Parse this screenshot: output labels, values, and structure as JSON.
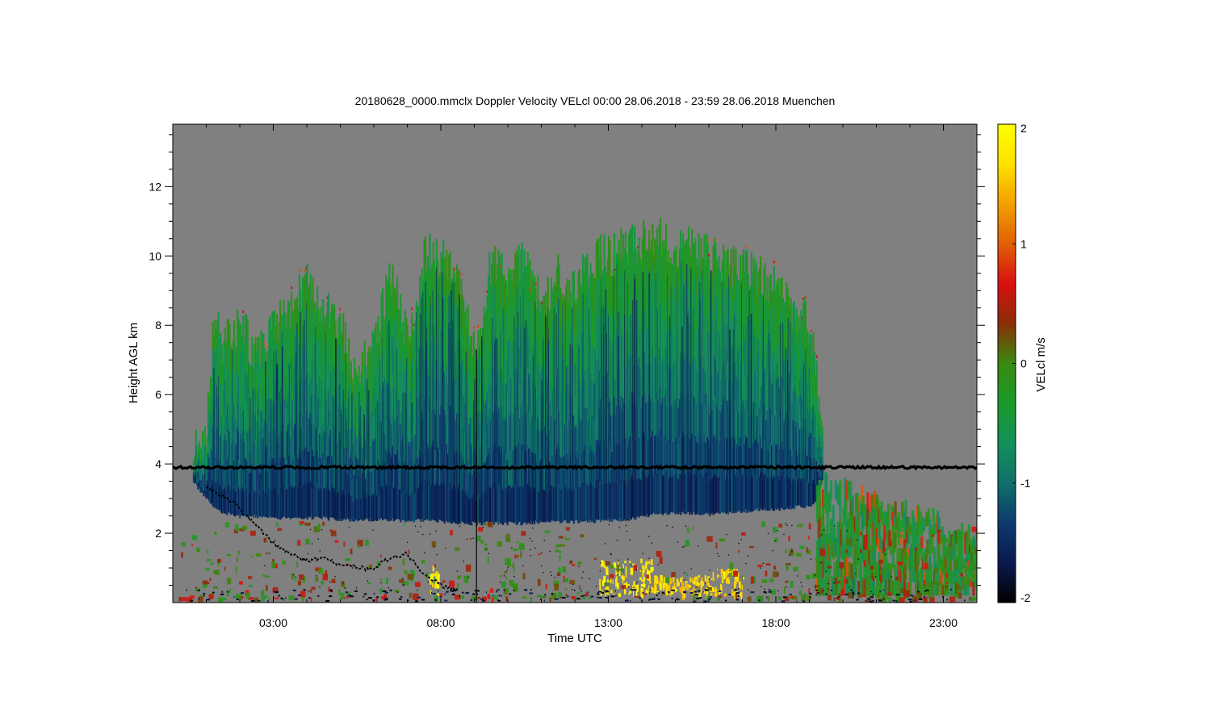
{
  "chart_data": {
    "type": "heatmap",
    "title": "20180628_0000.mmclx Doppler Velocity VELcl   00:00 28.06.2018 - 23:59 28.06.2018 Muenchen",
    "xlabel": "Time UTC",
    "ylabel": "Height AGL km",
    "x_unit": "hours UTC",
    "xlim": [
      0,
      24
    ],
    "ylim": [
      0,
      13.8
    ],
    "x_tick_values": [
      3,
      8,
      13,
      18,
      23
    ],
    "x_tick_labels": [
      "03:00",
      "08:00",
      "13:00",
      "18:00",
      "23:00"
    ],
    "y_tick_values": [
      2,
      4,
      6,
      8,
      10,
      12
    ],
    "y_tick_labels": [
      "2",
      "4",
      "6",
      "8",
      "10",
      "12"
    ],
    "colorbar": {
      "label": "VELcl m/s",
      "range": [
        -2,
        2
      ],
      "tick_values": [
        -2,
        -1,
        0,
        1,
        2
      ],
      "tick_labels": [
        "-2",
        "-1",
        "0",
        "1",
        "2"
      ],
      "colormap": [
        "#000000",
        "#0a1a50",
        "#0d3a6e",
        "#10706a",
        "#14905a",
        "#1a9a2a",
        "#3a8a10",
        "#8a2e08",
        "#d81010",
        "#e06006",
        "#f2a000",
        "#ffe100",
        "#ffff00"
      ]
    },
    "background_color": "#808080",
    "noise_band_height_km": 3.9,
    "cloud_mass": {
      "time": [
        0.6,
        1.0,
        1.2,
        1.5,
        2.0,
        2.5,
        3.0,
        3.5,
        4.0,
        4.5,
        5.0,
        5.5,
        6.0,
        6.5,
        7.0,
        7.5,
        8.0,
        8.5,
        9.0,
        9.5,
        10.0,
        10.5,
        11.0,
        11.5,
        12.0,
        12.5,
        13.0,
        13.5,
        14.0,
        14.5,
        15.0,
        15.5,
        16.0,
        16.5,
        17.0,
        17.5,
        18.0,
        18.5,
        19.0,
        19.2,
        19.4
      ],
      "top_km": [
        4.4,
        5.0,
        8.0,
        7.5,
        8.0,
        7.0,
        8.0,
        8.5,
        9.3,
        8.5,
        8.0,
        6.5,
        7.5,
        9.5,
        7.5,
        10.0,
        10.0,
        9.5,
        7.0,
        10.0,
        9.5,
        10.0,
        8.5,
        9.5,
        9.0,
        10.0,
        10.0,
        10.3,
        10.4,
        10.5,
        10.3,
        10.2,
        10.0,
        9.8,
        9.7,
        9.5,
        9.0,
        8.5,
        8.0,
        6.5,
        4.2
      ],
      "base_km": [
        3.5,
        3.0,
        2.8,
        2.6,
        2.5,
        2.5,
        2.45,
        2.45,
        2.45,
        2.45,
        2.4,
        2.4,
        2.4,
        2.4,
        2.35,
        2.4,
        2.35,
        2.3,
        2.3,
        2.3,
        2.3,
        2.3,
        2.35,
        2.35,
        2.35,
        2.35,
        2.4,
        2.4,
        2.5,
        2.6,
        2.6,
        2.6,
        2.55,
        2.6,
        2.65,
        2.7,
        2.7,
        2.75,
        2.8,
        3.0,
        3.6
      ]
    },
    "melting_layer_km": {
      "time": [
        1.0,
        1.8,
        2.5,
        3.0,
        3.5,
        4.0,
        4.5,
        5.0,
        5.5,
        6.0,
        6.5,
        7.0,
        7.5,
        8.0,
        8.5
      ],
      "height": [
        3.3,
        2.9,
        2.2,
        1.7,
        1.4,
        1.2,
        1.3,
        1.1,
        1.0,
        1.0,
        1.3,
        1.4,
        0.8,
        0.5,
        0.35
      ]
    },
    "updraft_patches": [
      {
        "t0": 12.7,
        "t1": 14.3,
        "h_max": 1.3,
        "velocity_ms": 2.0
      },
      {
        "t0": 14.3,
        "t1": 16.0,
        "h_max": 0.8,
        "velocity_ms": 1.8
      },
      {
        "t0": 16.0,
        "t1": 17.0,
        "h_max": 1.0,
        "velocity_ms": 1.9
      },
      {
        "t0": 7.6,
        "t1": 7.9,
        "h_max": 1.1,
        "velocity_ms": 2.0
      }
    ],
    "evening_precip": {
      "t0": 19.2,
      "t1": 24.0,
      "top_km": 3.6,
      "base_km": 0.2
    },
    "grid": false
  }
}
